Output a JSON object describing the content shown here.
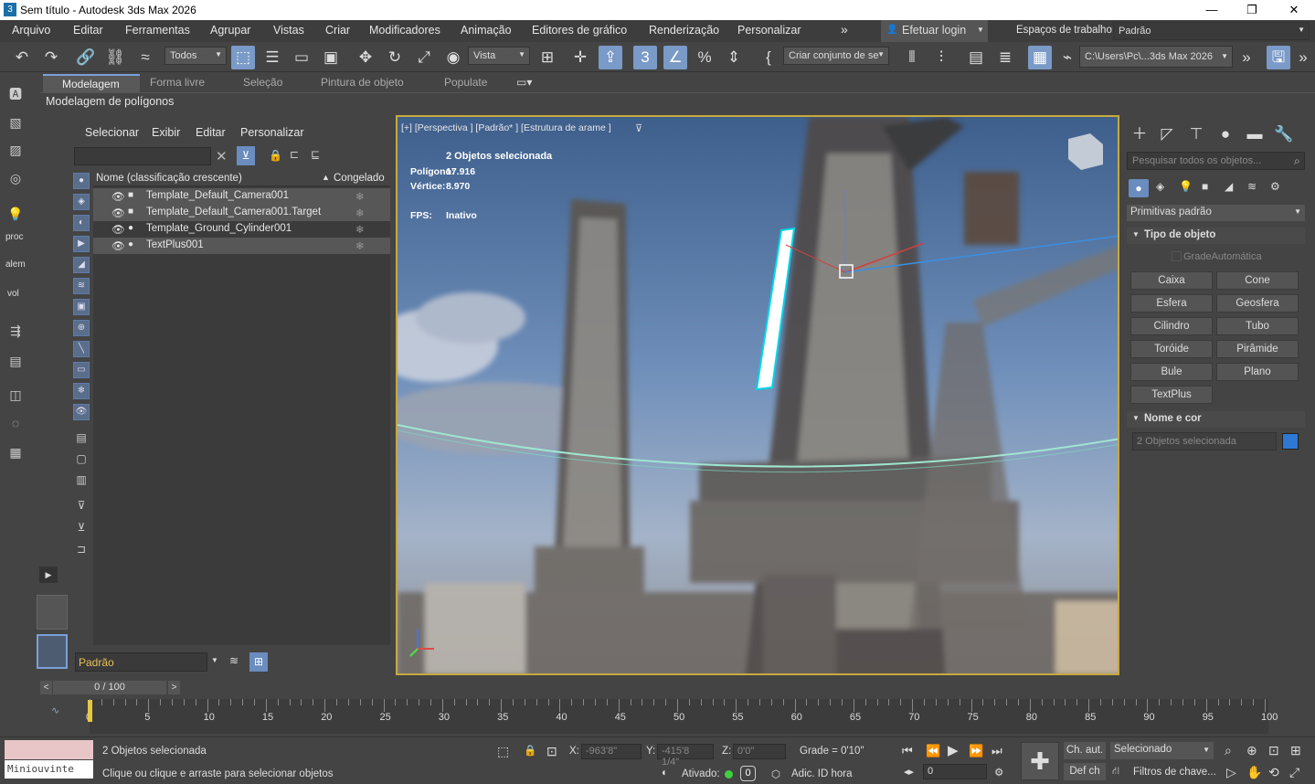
{
  "window": {
    "title": "Sem título - Autodesk 3ds Max 2026",
    "icon_text": "3",
    "controls": [
      "—",
      "❐",
      "✕"
    ]
  },
  "menu": [
    "Arquivo",
    "Editar",
    "Ferramentas",
    "Agrupar",
    "Vistas",
    "Criar",
    "Modificadores",
    "Animação",
    "Editores de gráfico",
    "Renderização",
    "Personalizar"
  ],
  "login": "Efetuar login",
  "workspace": {
    "label": "Espaços de trabalho:",
    "value": "Padrão"
  },
  "toolbar": {
    "filter": "Todos",
    "refcoord": "Vista",
    "selset": "Criar conjunto de se",
    "path": "C:\\Users\\Pc\\...3ds Max 2026"
  },
  "ribbon_tabs": [
    "Modelagem",
    "Forma livre",
    "Seleção",
    "Pintura de objeto",
    "Populate"
  ],
  "ribbon_sub": "Modelagem de polígonos",
  "scene_explorer": {
    "menu": [
      "Selecionar",
      "Exibir",
      "Editar",
      "Personalizar"
    ],
    "col_name": "Nome (classificação crescente)",
    "col_frozen": "Congelado",
    "rows": [
      {
        "name": "Template_Default_Camera001",
        "selected": true
      },
      {
        "name": "Template_Default_Camera001.Target",
        "selected": true
      },
      {
        "name": "Template_Ground_Cylinder001",
        "selected": false
      },
      {
        "name": "TextPlus001",
        "selected": true
      }
    ],
    "layer": "Padrão"
  },
  "left_labels": {
    "proc": "proc",
    "alem": "alem",
    "vol": "vol"
  },
  "viewport": {
    "label": "[+] [Perspectiva ] [Padrão* ] [Estrutura de arame ]",
    "sel_info": "2 Objetos selecionada",
    "poly_label": "Polígono:",
    "poly_value": "17.916",
    "vert_label": "Vértice:",
    "vert_value": "8.970",
    "fps_label": "FPS:",
    "fps_value": "Inativo"
  },
  "command_panel": {
    "search_placeholder": "Pesquisar todos os objetos...",
    "category": "Primitivas padrão",
    "rollout1": "Tipo de objeto",
    "autogrid": "GradeAutomática",
    "buttons": [
      "Caixa",
      "Cone",
      "Esfera",
      "Geosfera",
      "Cilindro",
      "Tubo",
      "Toróide",
      "Pirâmide",
      "Bule",
      "Plano",
      "TextPlus"
    ],
    "rollout2": "Nome e cor",
    "name_value": "2 Objetos selecionada",
    "color": "#2f78d4"
  },
  "timeline": {
    "frame": "0 / 100",
    "ticks": [
      "0",
      "5",
      "10",
      "15",
      "20",
      "25",
      "30",
      "35",
      "40",
      "45",
      "50",
      "55",
      "60",
      "65",
      "70",
      "75",
      "80",
      "85",
      "90",
      "95",
      "100"
    ]
  },
  "status": {
    "minilistener": "Miniouvinte",
    "selected": "2 Objetos selecionada",
    "prompt": "Clique ou clique e arraste para selecionar objetos",
    "x_label": "X:",
    "x": "-963'8\"",
    "y_label": "Y:",
    "y": "-415'8 1/4\"",
    "z_label": "Z:",
    "z": "0'0\"",
    "grid": "Grade = 0'10\"",
    "enabled": "Ativado:",
    "enabled_val": "0",
    "addtime": "Adic. ID hora",
    "autokey": "Ch. aut.",
    "setkey": "Def ch",
    "selmode": "Selecionado",
    "frame": "0",
    "keyfilters": "Filtros de chave..."
  }
}
